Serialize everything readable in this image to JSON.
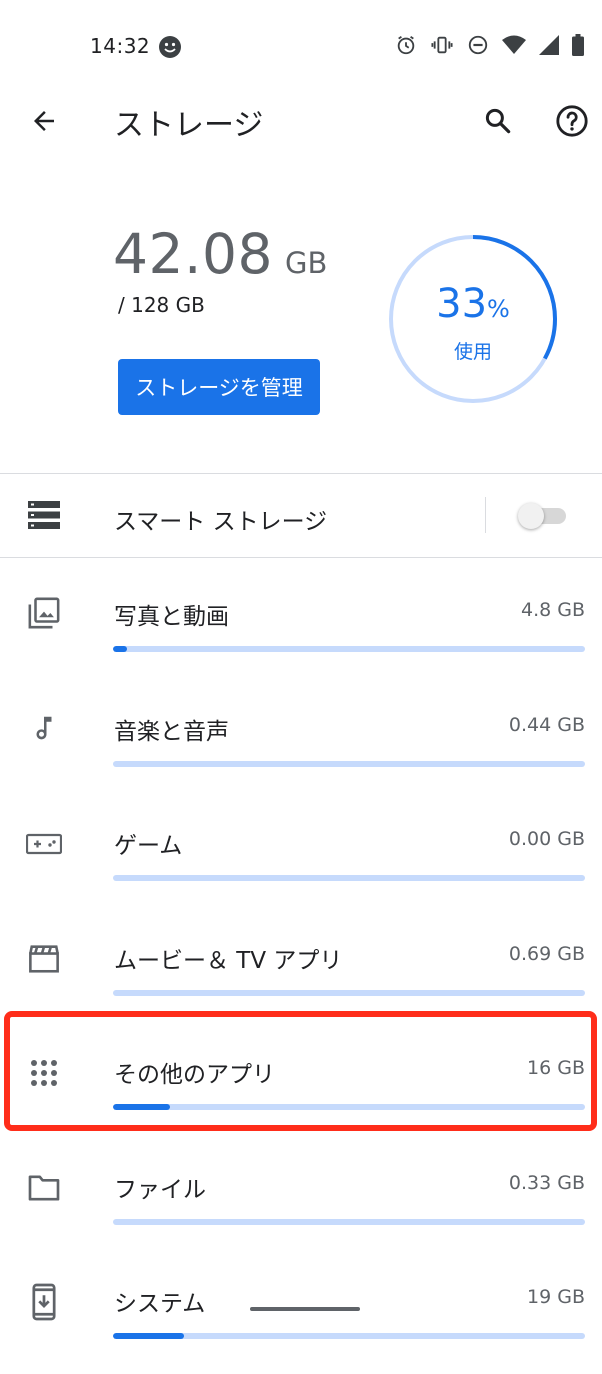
{
  "status_bar": {
    "time": "14:32"
  },
  "app_bar": {
    "title": "ストレージ"
  },
  "summary": {
    "used_value": "42.08",
    "used_unit": "GB",
    "total": "/ 128 GB",
    "manage_button": "ストレージを管理",
    "percent_value": "33",
    "percent_sign": "%",
    "percent_label": "使用",
    "percent_used": 0.33
  },
  "smart_storage": {
    "label": "スマート ストレージ",
    "enabled": false
  },
  "categories": [
    {
      "label": "写真と動画",
      "size": "4.8 GB",
      "fill": 0.03,
      "icon": "photo-icon"
    },
    {
      "label": "音楽と音声",
      "size": "0.44 GB",
      "fill": 0.0,
      "icon": "music-note-icon"
    },
    {
      "label": "ゲーム",
      "size": "0.00 GB",
      "fill": 0.0,
      "icon": "gamepad-icon"
    },
    {
      "label": "ムービー＆ TV アプリ",
      "size": "0.69 GB",
      "fill": 0.0,
      "icon": "movie-icon"
    },
    {
      "label": "その他のアプリ",
      "size": "16 GB",
      "fill": 0.12,
      "icon": "apps-grid-icon"
    },
    {
      "label": "ファイル",
      "size": "0.33 GB",
      "fill": 0.0,
      "icon": "folder-icon"
    },
    {
      "label": "システム",
      "size": "19 GB",
      "fill": 0.15,
      "icon": "system-update-icon"
    }
  ],
  "colors": {
    "accent": "#1a73e8",
    "track": "#c6dafc",
    "highlight": "#ff2d1a"
  }
}
